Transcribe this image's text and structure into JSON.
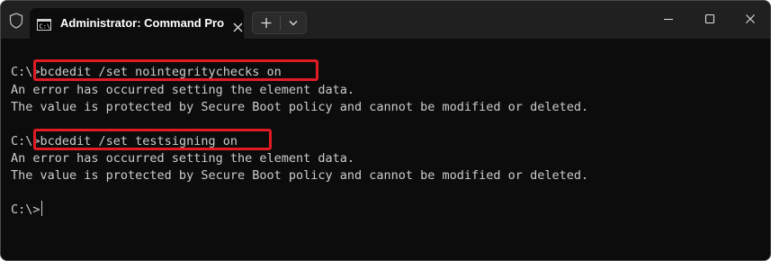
{
  "window": {
    "tab_title": "Administrator: Command Pro",
    "icons": {
      "shield": "shield-icon",
      "terminal": "cmd-icon",
      "close_tab": "close-icon",
      "new_tab": "plus-icon",
      "dropdown": "chevron-down-icon",
      "minimize": "minimize-icon",
      "maximize": "maximize-icon",
      "close": "close-icon"
    }
  },
  "terminal": {
    "lines": [
      {
        "prompt": "C:\\>",
        "command": "bcdedit /set nointegritychecks on"
      },
      {
        "text": "An error has occurred setting the element data."
      },
      {
        "text": "The value is protected by Secure Boot policy and cannot be modified or deleted."
      },
      {
        "prompt": "C:\\>",
        "command": "bcdedit /set testsigning on"
      },
      {
        "text": "An error has occurred setting the element data."
      },
      {
        "text": "The value is protected by Secure Boot policy and cannot be modified or deleted."
      },
      {
        "prompt": "C:\\>"
      }
    ]
  },
  "colors": {
    "highlight": "#e01b24",
    "terminal_bg": "#0c0c0c",
    "terminal_text": "#cccccc",
    "titlebar_bg": "#202020"
  }
}
